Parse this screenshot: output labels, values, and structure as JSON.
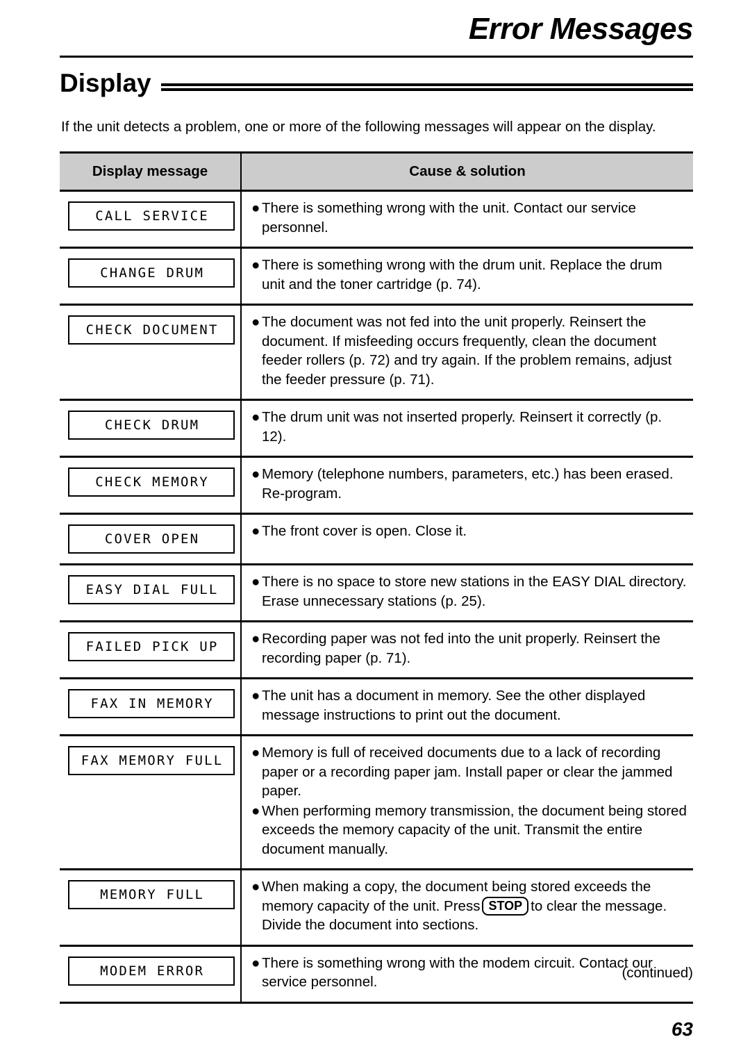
{
  "chapter": {
    "title": "Error Messages"
  },
  "section": {
    "title": "Display"
  },
  "intro": "If the unit detects a problem, one or more of the following messages will appear on the display.",
  "table": {
    "headers": {
      "display_message": "Display message",
      "cause_solution": "Cause & solution"
    },
    "rows": [
      {
        "message": "CALL SERVICE",
        "bullets": [
          {
            "pre": "There is something wrong with the unit. Contact our service personnel."
          }
        ]
      },
      {
        "message": "CHANGE DRUM",
        "bullets": [
          {
            "pre": "There is something wrong with the drum unit. Replace the drum unit and the toner cartridge (p. 74)."
          }
        ]
      },
      {
        "message": "CHECK DOCUMENT",
        "bullets": [
          {
            "pre": "The document was not fed into the unit properly. Reinsert the document. If misfeeding occurs frequently, clean the document feeder rollers (p. 72) and try again. If the problem remains, adjust the feeder pressure (p. 71)."
          }
        ]
      },
      {
        "message": "CHECK DRUM",
        "bullets": [
          {
            "pre": "The drum unit was not inserted properly. Reinsert it correctly (p. 12)."
          }
        ]
      },
      {
        "message": "CHECK MEMORY",
        "bullets": [
          {
            "pre": "Memory (telephone numbers, parameters, etc.) has been erased. Re-program."
          }
        ]
      },
      {
        "message": "COVER OPEN",
        "bullets": [
          {
            "pre": "The front cover is open. Close it."
          }
        ]
      },
      {
        "message": "EASY DIAL FULL",
        "bullets": [
          {
            "pre": "There is no space to store new stations in the EASY DIAL directory. Erase unnecessary stations (p. 25)."
          }
        ]
      },
      {
        "message": "FAILED PICK UP",
        "bullets": [
          {
            "pre": "Recording paper was not fed into the unit properly. Reinsert the recording paper (p. 71)."
          }
        ]
      },
      {
        "message": "FAX IN MEMORY",
        "bullets": [
          {
            "pre": "The unit has a document in memory. See the other displayed message instructions to print out the document."
          }
        ]
      },
      {
        "message": "FAX MEMORY FULL",
        "bullets": [
          {
            "pre": "Memory is full of received documents due to a lack of recording paper or a recording paper jam. Install paper or clear the jammed paper."
          },
          {
            "pre": "When performing memory transmission, the document being stored exceeds the memory capacity of the unit. Transmit the entire document manually."
          }
        ]
      },
      {
        "message": "MEMORY FULL",
        "bullets": [
          {
            "pre": "When making a copy, the document being stored exceeds the memory capacity of the unit. Press",
            "key": "STOP",
            "post": "to clear the message. Divide the document into sections."
          }
        ]
      },
      {
        "message": "MODEM ERROR",
        "bullets": [
          {
            "pre": "There is something wrong with the modem circuit. Contact our service personnel."
          }
        ]
      }
    ]
  },
  "footer": {
    "continued": "(continued)",
    "page_number": "63"
  },
  "icons": {
    "bullet": "●"
  },
  "colors": {
    "header_fill": "#cccccc",
    "rule": "#000000",
    "text": "#000000",
    "page_background": "#ffffff"
  }
}
